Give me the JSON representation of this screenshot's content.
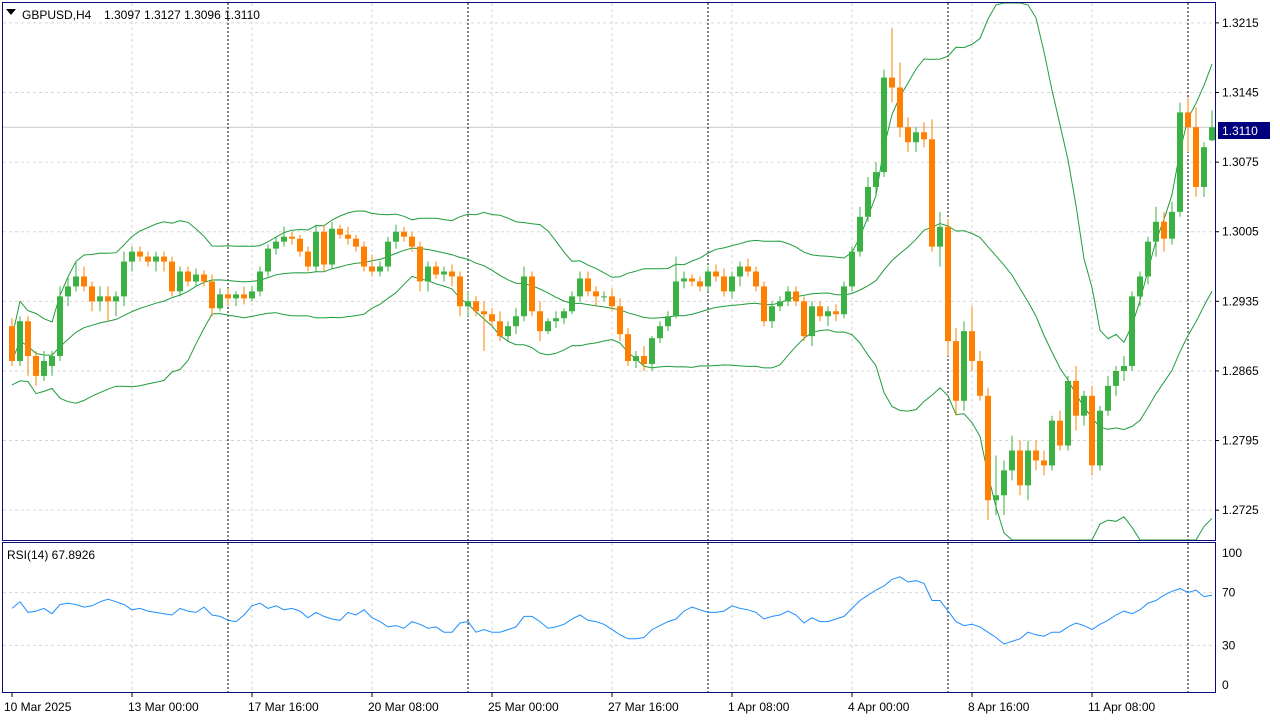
{
  "header": {
    "symbol_timeframe": "GBPUSD,H4",
    "ohlc": "1.3097 1.3127 1.3096 1.3110"
  },
  "rsi_label": "RSI(14) 67.8926",
  "price_axis": {
    "ticks": [
      "1.3215",
      "1.3145",
      "1.3075",
      "1.3005",
      "1.2935",
      "1.2865",
      "1.2795",
      "1.2725"
    ]
  },
  "rsi_axis": {
    "ticks": [
      "100",
      "70",
      "30",
      "0"
    ]
  },
  "current_price_label": "1.3110",
  "time_axis": {
    "labels": [
      "10 Mar 2025",
      "13 Mar 00:00",
      "17 Mar 16:00",
      "20 Mar 08:00",
      "25 Mar 00:00",
      "27 Mar 16:00",
      "1 Apr 08:00",
      "4 Apr 00:00",
      "8 Apr 16:00",
      "11 Apr 08:00"
    ]
  },
  "colors": {
    "bull": "#3bb143",
    "bear": "#ff8000",
    "band": "#1e9c3c",
    "rsi": "#1e90ff",
    "price_tag_bg": "#00007f",
    "border": "#0b0b7a"
  },
  "chart_data": {
    "type": "candlestick",
    "symbol": "GBPUSD",
    "timeframe": "H4",
    "price_range": [
      1.2695,
      1.3235
    ],
    "rsi_range": [
      0,
      100
    ],
    "rsi_levels": [
      30,
      70
    ],
    "candles": [
      [
        1.291,
        1.2918,
        1.287,
        1.2875
      ],
      [
        1.2875,
        1.292,
        1.287,
        1.2915
      ],
      [
        1.2915,
        1.292,
        1.286,
        1.288
      ],
      [
        1.288,
        1.2885,
        1.285,
        1.286
      ],
      [
        1.286,
        1.2885,
        1.2855,
        1.2875
      ],
      [
        1.287,
        1.2885,
        1.286,
        1.288
      ],
      [
        1.288,
        1.295,
        1.2875,
        1.294
      ],
      [
        1.294,
        1.296,
        1.293,
        1.295
      ],
      [
        1.295,
        1.2975,
        1.2945,
        1.296
      ],
      [
        1.296,
        1.297,
        1.2945,
        1.295
      ],
      [
        1.295,
        1.2955,
        1.2925,
        1.2935
      ],
      [
        1.2935,
        1.295,
        1.2925,
        1.294
      ],
      [
        1.294,
        1.295,
        1.2915,
        1.2935
      ],
      [
        1.2935,
        1.2945,
        1.292,
        1.294
      ],
      [
        1.294,
        1.2985,
        1.293,
        1.2975
      ],
      [
        1.2975,
        1.299,
        1.2965,
        1.2985
      ],
      [
        1.2985,
        1.299,
        1.2975,
        1.298
      ],
      [
        1.298,
        1.2985,
        1.297,
        1.2975
      ],
      [
        1.2975,
        1.2985,
        1.2965,
        1.298
      ],
      [
        1.298,
        1.2985,
        1.2965,
        1.2975
      ],
      [
        1.2975,
        1.298,
        1.294,
        1.2945
      ],
      [
        1.2945,
        1.297,
        1.294,
        1.2965
      ],
      [
        1.2965,
        1.297,
        1.295,
        1.2955
      ],
      [
        1.2955,
        1.2968,
        1.295,
        1.2962
      ],
      [
        1.2962,
        1.2966,
        1.295,
        1.2955
      ],
      [
        1.2955,
        1.2962,
        1.292,
        1.2928
      ],
      [
        1.2928,
        1.2948,
        1.2925,
        1.2942
      ],
      [
        1.2942,
        1.2948,
        1.293,
        1.2938
      ],
      [
        1.2938,
        1.2945,
        1.293,
        1.2942
      ],
      [
        1.2942,
        1.295,
        1.2932,
        1.2938
      ],
      [
        1.2938,
        1.295,
        1.2935,
        1.2945
      ],
      [
        1.2945,
        1.297,
        1.294,
        1.2965
      ],
      [
        1.2965,
        1.2992,
        1.296,
        1.2988
      ],
      [
        1.2988,
        1.3,
        1.2982,
        1.2995
      ],
      [
        1.2995,
        1.301,
        1.299,
        1.3
      ],
      [
        1.3,
        1.3005,
        1.2992,
        1.2998
      ],
      [
        1.2998,
        1.3002,
        1.298,
        1.2985
      ],
      [
        1.2985,
        1.299,
        1.2965,
        1.297
      ],
      [
        1.297,
        1.3012,
        1.2965,
        1.3005
      ],
      [
        1.3005,
        1.3012,
        1.2965,
        1.2972
      ],
      [
        1.2972,
        1.3015,
        1.2968,
        1.3008
      ],
      [
        1.3008,
        1.3012,
        1.2998,
        1.3002
      ],
      [
        1.3002,
        1.301,
        1.2992,
        1.2998
      ],
      [
        1.2998,
        1.3002,
        1.2985,
        1.299
      ],
      [
        1.299,
        1.2995,
        1.2965,
        1.297
      ],
      [
        1.297,
        1.2982,
        1.296,
        1.2965
      ],
      [
        1.2965,
        1.2975,
        1.296,
        1.297
      ],
      [
        1.297,
        1.3,
        1.2965,
        1.2995
      ],
      [
        1.2995,
        1.3012,
        1.2988,
        1.3005
      ],
      [
        1.3005,
        1.301,
        1.2995,
        1.3
      ],
      [
        1.3,
        1.3005,
        1.2985,
        1.299
      ],
      [
        1.299,
        1.2995,
        1.2945,
        1.2955
      ],
      [
        1.2955,
        1.2975,
        1.2945,
        1.297
      ],
      [
        1.297,
        1.2975,
        1.2958,
        1.2962
      ],
      [
        1.2962,
        1.297,
        1.2955,
        1.2965
      ],
      [
        1.2965,
        1.2972,
        1.295,
        1.296
      ],
      [
        1.296,
        1.2965,
        1.292,
        1.293
      ],
      [
        1.293,
        1.2945,
        1.292,
        1.2935
      ],
      [
        1.2935,
        1.294,
        1.292,
        1.2925
      ],
      [
        1.2925,
        1.2935,
        1.2885,
        1.2922
      ],
      [
        1.2922,
        1.2928,
        1.291,
        1.2915
      ],
      [
        1.2915,
        1.2925,
        1.2895,
        1.29
      ],
      [
        1.29,
        1.2915,
        1.2895,
        1.291
      ],
      [
        1.291,
        1.2928,
        1.2902,
        1.292
      ],
      [
        1.292,
        1.297,
        1.2915,
        1.296
      ],
      [
        1.296,
        1.2965,
        1.292,
        1.2925
      ],
      [
        1.2925,
        1.2935,
        1.2895,
        1.2905
      ],
      [
        1.2905,
        1.2918,
        1.2902,
        1.2915
      ],
      [
        1.2915,
        1.2925,
        1.2908,
        1.2918
      ],
      [
        1.2918,
        1.2928,
        1.2912,
        1.2925
      ],
      [
        1.2925,
        1.2945,
        1.2922,
        1.294
      ],
      [
        1.294,
        1.2965,
        1.2935,
        1.2958
      ],
      [
        1.2958,
        1.2965,
        1.294,
        1.2945
      ],
      [
        1.2945,
        1.295,
        1.293,
        1.294
      ],
      [
        1.294,
        1.2945,
        1.2935,
        1.294
      ],
      [
        1.294,
        1.2948,
        1.2925,
        1.293
      ],
      [
        1.293,
        1.2938,
        1.2895,
        1.2902
      ],
      [
        1.2902,
        1.2908,
        1.287,
        1.2875
      ],
      [
        1.2875,
        1.2885,
        1.2868,
        1.288
      ],
      [
        1.288,
        1.289,
        1.2865,
        1.2872
      ],
      [
        1.2872,
        1.29,
        1.2865,
        1.2898
      ],
      [
        1.2898,
        1.2915,
        1.2893,
        1.291
      ],
      [
        1.291,
        1.2925,
        1.2905,
        1.292
      ],
      [
        1.292,
        1.298,
        1.2918,
        1.2955
      ],
      [
        1.2955,
        1.2965,
        1.2948,
        1.2958
      ],
      [
        1.2958,
        1.2962,
        1.295,
        1.2955
      ],
      [
        1.2955,
        1.296,
        1.2945,
        1.295
      ],
      [
        1.295,
        1.297,
        1.2945,
        1.2965
      ],
      [
        1.2965,
        1.2972,
        1.2955,
        1.296
      ],
      [
        1.296,
        1.2968,
        1.294,
        1.2945
      ],
      [
        1.2945,
        1.2965,
        1.2938,
        1.296
      ],
      [
        1.296,
        1.2975,
        1.295,
        1.297
      ],
      [
        1.297,
        1.2978,
        1.296,
        1.2965
      ],
      [
        1.2965,
        1.297,
        1.2945,
        1.295
      ],
      [
        1.295,
        1.2955,
        1.291,
        1.2915
      ],
      [
        1.2915,
        1.2935,
        1.2908,
        1.293
      ],
      [
        1.293,
        1.294,
        1.2925,
        1.2935
      ],
      [
        1.2935,
        1.295,
        1.293,
        1.2945
      ],
      [
        1.2945,
        1.295,
        1.293,
        1.2935
      ],
      [
        1.2935,
        1.294,
        1.2895,
        1.29
      ],
      [
        1.29,
        1.2935,
        1.289,
        1.293
      ],
      [
        1.293,
        1.2935,
        1.2915,
        1.292
      ],
      [
        1.292,
        1.293,
        1.291,
        1.2925
      ],
      [
        1.2925,
        1.2932,
        1.2915,
        1.2922
      ],
      [
        1.2922,
        1.2955,
        1.2918,
        1.295
      ],
      [
        1.295,
        1.299,
        1.2945,
        1.2985
      ],
      [
        1.2985,
        1.303,
        1.298,
        1.302
      ],
      [
        1.302,
        1.306,
        1.3015,
        1.305
      ],
      [
        1.305,
        1.3075,
        1.304,
        1.3065
      ],
      [
        1.3065,
        1.3168,
        1.306,
        1.316
      ],
      [
        1.316,
        1.321,
        1.3135,
        1.315
      ],
      [
        1.315,
        1.3175,
        1.31,
        1.311
      ],
      [
        1.311,
        1.312,
        1.3085,
        1.3095
      ],
      [
        1.3095,
        1.311,
        1.3085,
        1.3105
      ],
      [
        1.3105,
        1.3115,
        1.309,
        1.3098
      ],
      [
        1.3098,
        1.3118,
        1.2985,
        1.299
      ],
      [
        1.299,
        1.3025,
        1.297,
        1.301
      ],
      [
        1.301,
        1.3018,
        1.288,
        1.2895
      ],
      [
        1.2895,
        1.2908,
        1.282,
        1.2835
      ],
      [
        1.2835,
        1.2915,
        1.2825,
        1.2905
      ],
      [
        1.2905,
        1.293,
        1.2865,
        1.2875
      ],
      [
        1.2875,
        1.2885,
        1.2835,
        1.284
      ],
      [
        1.284,
        1.2848,
        1.2715,
        1.2735
      ],
      [
        1.2735,
        1.278,
        1.272,
        1.274
      ],
      [
        1.274,
        1.2775,
        1.272,
        1.2765
      ],
      [
        1.2765,
        1.28,
        1.2755,
        1.2785
      ],
      [
        1.2785,
        1.2795,
        1.274,
        1.275
      ],
      [
        1.275,
        1.2795,
        1.2735,
        1.2785
      ],
      [
        1.2785,
        1.2795,
        1.2765,
        1.2775
      ],
      [
        1.2775,
        1.2785,
        1.276,
        1.277
      ],
      [
        1.277,
        1.282,
        1.2765,
        1.2815
      ],
      [
        1.2815,
        1.2825,
        1.2785,
        1.279
      ],
      [
        1.279,
        1.286,
        1.2785,
        1.2855
      ],
      [
        1.2855,
        1.287,
        1.2805,
        1.282
      ],
      [
        1.282,
        1.2845,
        1.281,
        1.284
      ],
      [
        1.284,
        1.285,
        1.276,
        1.277
      ],
      [
        1.277,
        1.283,
        1.2765,
        1.2825
      ],
      [
        1.2825,
        1.286,
        1.282,
        1.285
      ],
      [
        1.285,
        1.287,
        1.284,
        1.2865
      ],
      [
        1.2865,
        1.288,
        1.2855,
        1.287
      ],
      [
        1.287,
        1.2945,
        1.2865,
        1.294
      ],
      [
        1.294,
        1.2965,
        1.293,
        1.296
      ],
      [
        1.296,
        1.3,
        1.2952,
        1.2995
      ],
      [
        1.2995,
        1.303,
        1.298,
        1.3015
      ],
      [
        1.3015,
        1.3025,
        1.2985,
        1.2998
      ],
      [
        1.2998,
        1.3035,
        1.2992,
        1.3025
      ],
      [
        1.3025,
        1.3135,
        1.302,
        1.3125
      ],
      [
        1.3125,
        1.314,
        1.3085,
        1.311
      ],
      [
        1.311,
        1.313,
        1.304,
        1.305
      ],
      [
        1.305,
        1.3095,
        1.304,
        1.309
      ],
      [
        1.3097,
        1.3127,
        1.3096,
        1.311
      ]
    ],
    "rsi": [
      58,
      63,
      55,
      56,
      58,
      54,
      61,
      62,
      61,
      59,
      60,
      63,
      65,
      63,
      61,
      57,
      58,
      56,
      55,
      54,
      53,
      58,
      56,
      55,
      59,
      53,
      52,
      49,
      48,
      53,
      60,
      62,
      58,
      60,
      57,
      58,
      56,
      51,
      55,
      52,
      50,
      49,
      55,
      53,
      57,
      51,
      48,
      44,
      45,
      43,
      48,
      46,
      43,
      44,
      40,
      40,
      47,
      48,
      40,
      42,
      40,
      40,
      42,
      44,
      52,
      52,
      48,
      43,
      44,
      46,
      50,
      53,
      49,
      48,
      46,
      42,
      38,
      35,
      35,
      36,
      42,
      45,
      48,
      50,
      56,
      59,
      57,
      55,
      55,
      56,
      60,
      58,
      57,
      55,
      50,
      52,
      53,
      56,
      53,
      47,
      51,
      48,
      48,
      50,
      52,
      58,
      64,
      68,
      72,
      75,
      80,
      82,
      78,
      79,
      77,
      64,
      64,
      56,
      48,
      45,
      46,
      44,
      40,
      36,
      31,
      33,
      35,
      40,
      38,
      37,
      40,
      40,
      44,
      47,
      45,
      42,
      46,
      49,
      53,
      56,
      54,
      57,
      62,
      64,
      68,
      71,
      73,
      70,
      72,
      67,
      68
    ]
  }
}
